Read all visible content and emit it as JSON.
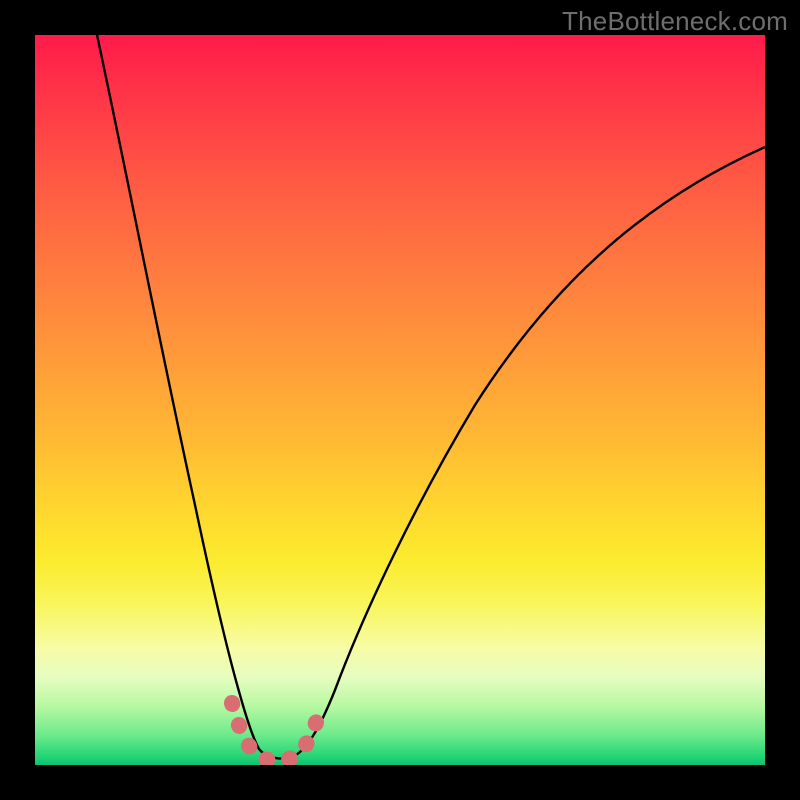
{
  "watermark": "TheBottleneck.com",
  "chart_data": {
    "type": "line",
    "title": "",
    "xlabel": "",
    "ylabel": "",
    "xlim": [
      0,
      1
    ],
    "ylim": [
      0,
      1
    ],
    "series": [
      {
        "name": "bottleneck-curve",
        "x": [
          0.02,
          0.05,
          0.1,
          0.14,
          0.18,
          0.22,
          0.26,
          0.28,
          0.3,
          0.32,
          0.34,
          0.36,
          0.4,
          0.46,
          0.54,
          0.64,
          0.76,
          0.88,
          1.0
        ],
        "values": [
          1.0,
          0.88,
          0.7,
          0.55,
          0.4,
          0.25,
          0.1,
          0.03,
          0.0,
          0.0,
          0.0,
          0.03,
          0.1,
          0.22,
          0.36,
          0.52,
          0.66,
          0.77,
          0.85
        ]
      }
    ],
    "highlight_region": {
      "name": "minimum-band",
      "x": [
        0.265,
        0.285,
        0.3,
        0.32,
        0.34,
        0.365,
        0.385
      ],
      "values": [
        0.085,
        0.03,
        0.005,
        0.005,
        0.005,
        0.03,
        0.085
      ],
      "color": "#d86d72"
    },
    "gradient_stops": [
      {
        "pos": 0.0,
        "color": "#ff1b4a"
      },
      {
        "pos": 0.5,
        "color": "#ffb834"
      },
      {
        "pos": 0.8,
        "color": "#f9f65c"
      },
      {
        "pos": 1.0,
        "color": "#0fbf76"
      }
    ]
  }
}
